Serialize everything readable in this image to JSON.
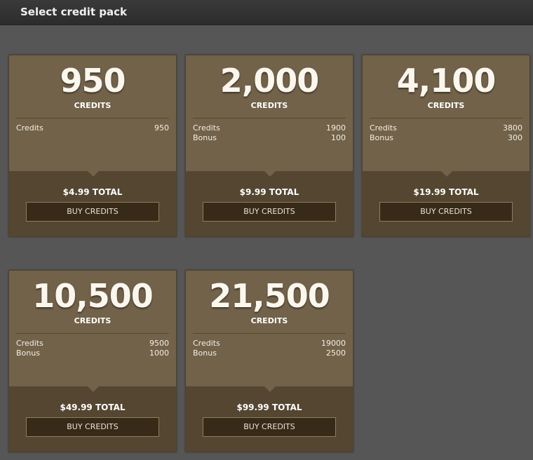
{
  "header": {
    "title": "Select credit pack"
  },
  "packs": [
    {
      "amount": "950",
      "unit": "CREDITS",
      "rows": [
        {
          "label": "Credits",
          "value": "950"
        }
      ],
      "total": "$4.99 TOTAL",
      "button": "BUY CREDITS"
    },
    {
      "amount": "2,000",
      "unit": "CREDITS",
      "rows": [
        {
          "label": "Credits",
          "value": "1900"
        },
        {
          "label": "Bonus",
          "value": "100"
        }
      ],
      "total": "$9.99 TOTAL",
      "button": "BUY CREDITS"
    },
    {
      "amount": "4,100",
      "unit": "CREDITS",
      "rows": [
        {
          "label": "Credits",
          "value": "3800"
        },
        {
          "label": "Bonus",
          "value": "300"
        }
      ],
      "total": "$19.99 TOTAL",
      "button": "BUY CREDITS"
    },
    {
      "amount": "10,500",
      "unit": "CREDITS",
      "rows": [
        {
          "label": "Credits",
          "value": "9500"
        },
        {
          "label": "Bonus",
          "value": "1000"
        }
      ],
      "total": "$49.99 TOTAL",
      "button": "BUY CREDITS"
    },
    {
      "amount": "21,500",
      "unit": "CREDITS",
      "rows": [
        {
          "label": "Credits",
          "value": "19000"
        },
        {
          "label": "Bonus",
          "value": "2500"
        }
      ],
      "total": "$99.99 TOTAL",
      "button": "BUY CREDITS"
    }
  ],
  "colors": {
    "background": "#565656",
    "card_top": "#716249",
    "card_bottom": "#544630",
    "button": "#382a18"
  }
}
